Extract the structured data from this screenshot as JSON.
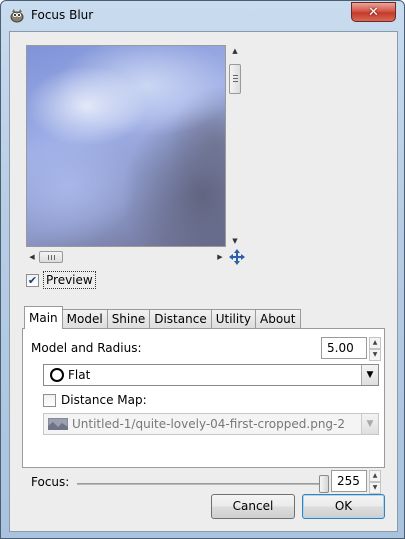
{
  "window": {
    "title": "Focus Blur",
    "close_glyph": "✕",
    "app_icon": "gimp-wilber-icon"
  },
  "preview": {
    "checkbox_checked": true,
    "label": "Preview",
    "navigate_icon": "move-arrows-icon"
  },
  "tabs": [
    {
      "label": "Main",
      "active": true
    },
    {
      "label": "Model",
      "active": false
    },
    {
      "label": "Shine",
      "active": false
    },
    {
      "label": "Distance",
      "active": false
    },
    {
      "label": "Utility",
      "active": false
    },
    {
      "label": "About",
      "active": false
    }
  ],
  "main": {
    "model_radius_label": "Model and Radius:",
    "radius_value": "5.00",
    "model_select_value": "Flat",
    "model_icon": "circle-aperture-icon",
    "distance_map_label": "Distance Map:",
    "distance_map_checked": false,
    "distance_map_value": "Untitled-1/quite-lovely-04-first-cropped.png-2",
    "focus_label": "Focus:",
    "focus_value": "255"
  },
  "buttons": {
    "cancel": "Cancel",
    "ok": "OK"
  }
}
